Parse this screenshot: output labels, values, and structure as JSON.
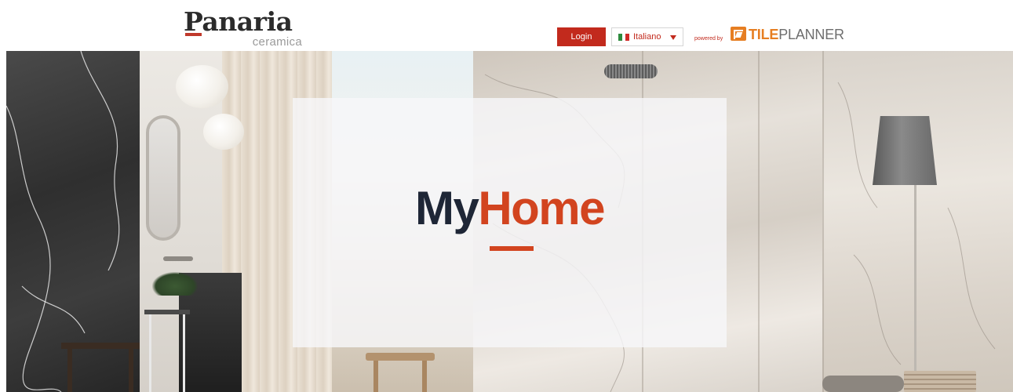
{
  "header": {
    "logo": {
      "name": "Panaria",
      "subtitle": "ceramica"
    },
    "login_label": "Login",
    "language": {
      "selected": "Italiano"
    },
    "powered": {
      "prefix": "powered by",
      "brand_bold": "TILE",
      "brand_light": "PLANNER"
    }
  },
  "hero": {
    "title_part1": "My",
    "title_part2": "Home"
  },
  "colors": {
    "accent": "#d2441f",
    "login_button": "#c22a1d",
    "title_dark": "#1e2636",
    "tileplanner_orange": "#e67e22"
  },
  "icons": [
    "italy-flag-icon",
    "caret-down-icon",
    "tileplanner-logo-icon"
  ]
}
